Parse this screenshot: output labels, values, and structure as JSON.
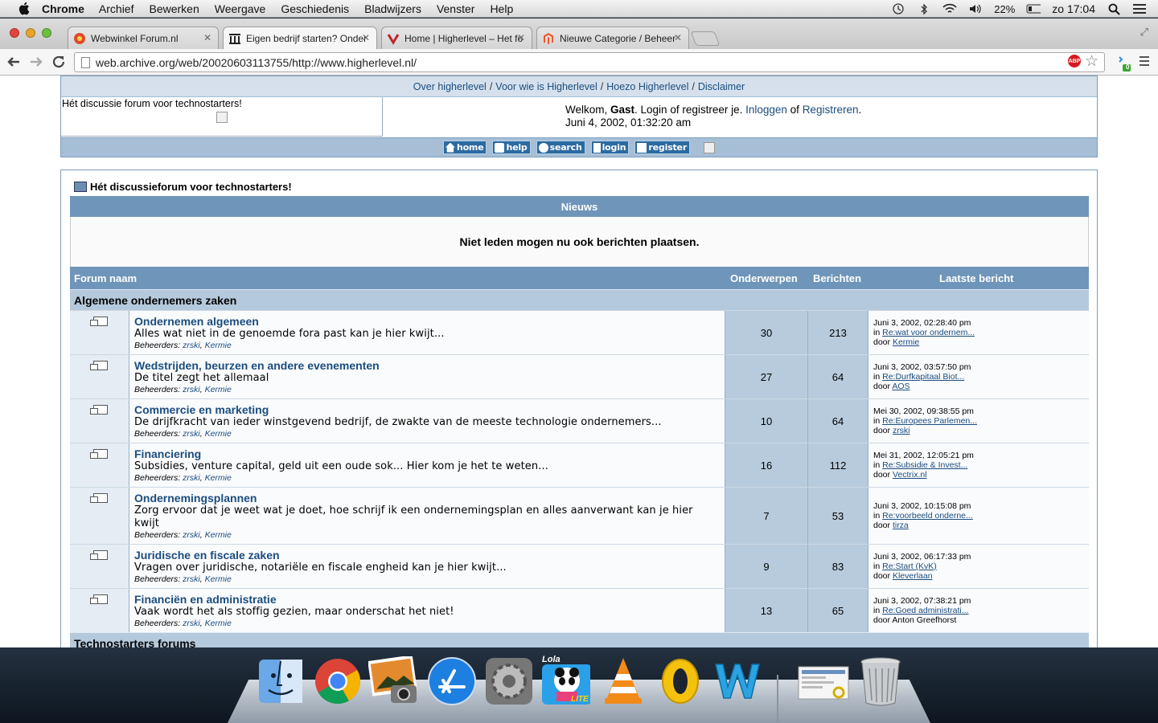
{
  "menubar": {
    "app": "Chrome",
    "items": [
      "Archief",
      "Bewerken",
      "Weergave",
      "Geschiedenis",
      "Bladwijzers",
      "Venster",
      "Help"
    ],
    "battery": "22%",
    "clock": "zo 17:04"
  },
  "tabs": [
    {
      "title": "Webwinkel Forum.nl",
      "active": false
    },
    {
      "title": "Eigen bedrijf starten? Onder",
      "active": true
    },
    {
      "title": "Home | Higherlevel – Het fo",
      "active": false
    },
    {
      "title": "Nieuwe Categorie / Beheer",
      "active": false
    }
  ],
  "address": "web.archive.org/web/20020603113755/http://www.higherlevel.nl/",
  "extension_badge": "0",
  "abp_label": "ABP",
  "site": {
    "topnav": [
      "Over higherlevel",
      "Voor wie is Higherlevel",
      "Hoezo Higherlevel",
      "Disclaimer"
    ],
    "tagline": "Hét discussie forum voor technostarters!",
    "welcome": {
      "prefix": "Welkom, ",
      "guest": "Gast",
      "mid": ". Login of registreer je. ",
      "login_link": "Inloggen",
      "of": " of ",
      "register_link": "Registreren",
      "suffix": ".",
      "date": "Juni 4, 2002, 01:32:20 am"
    },
    "buttons": [
      "home",
      "help",
      "search",
      "login",
      "register"
    ]
  },
  "board": {
    "title": "Hét discussieforum voor technostarters!",
    "news_header": "Nieuws",
    "news_text": "Niet leden mogen nu ook berichten plaatsen.",
    "columns": {
      "name": "Forum naam",
      "topics": "Onderwerpen",
      "posts": "Berichten",
      "last": "Laatste bericht"
    },
    "category": "Algemene ondernemers zaken",
    "next_category": "Technostarters forums",
    "mods_label": "Beheerders:",
    "mods": [
      "zrski",
      "Kermie"
    ],
    "forums": [
      {
        "name": "Ondernemen algemeen",
        "desc": "Alles wat niet in de genoemde fora past kan je hier kwijt...",
        "topics": "30",
        "posts": "213",
        "last_date": "Juni 3, 2002, 02:28:40 pm",
        "last_topic": "Re:wat voor ondernem...",
        "last_by": "Kermie",
        "by_link": true
      },
      {
        "name": "Wedstrijden, beurzen en andere evenementen",
        "desc": "De titel zegt het allemaal",
        "topics": "27",
        "posts": "64",
        "last_date": "Juni 3, 2002, 03:57:50 pm",
        "last_topic": "Re:Durfkapitaal Biot...",
        "last_by": "AOS",
        "by_link": true
      },
      {
        "name": "Commercie en marketing",
        "desc": "De drijfkracht van ieder winstgevend bedrijf, de zwakte van de meeste technologie ondernemers...",
        "topics": "10",
        "posts": "64",
        "last_date": "Mei 30, 2002, 09:38:55 pm",
        "last_topic": "Re:Europees Parlemen...",
        "last_by": "zrski",
        "by_link": true
      },
      {
        "name": "Financiering",
        "desc": "Subsidies, venture capital, geld uit een oude sok... Hier kom je het te weten...",
        "topics": "16",
        "posts": "112",
        "last_date": "Mei 31, 2002, 12:05:21 pm",
        "last_topic": "Re:Subsidie & Invest...",
        "last_by": "Vectrix.nl",
        "by_link": true
      },
      {
        "name": "Ondernemingsplannen",
        "desc": "Zorg ervoor dat je weet wat je doet, hoe schrijf ik een ondernemingsplan en alles aanverwant kan je hier kwijt",
        "topics": "7",
        "posts": "53",
        "last_date": "Juni 3, 2002, 10:15:08 pm",
        "last_topic": "Re:voorbeeld onderne...",
        "last_by": "tirza",
        "by_link": true
      },
      {
        "name": "Juridische en fiscale zaken",
        "desc": "Vragen over juridische, notariële en fiscale engheid kan je hier kwijt...",
        "topics": "9",
        "posts": "83",
        "last_date": "Juni 3, 2002, 06:17:33 pm",
        "last_topic": "Re:Start (KvK)",
        "last_by": "Kleverlaan",
        "by_link": true
      },
      {
        "name": "Financiën en administratie",
        "desc": "Vaak wordt het als stoffig gezien, maar onderschat het niet!",
        "topics": "13",
        "posts": "65",
        "last_date": "Juni 3, 2002, 07:38:21 pm",
        "last_topic": "Re:Goed administrati...",
        "last_by": "Anton Greefhorst",
        "by_link": false
      }
    ],
    "in_label": "in",
    "door_label": "door"
  },
  "dock": [
    "Finder",
    "Chrome",
    "iPhoto",
    "App Store",
    "Systeemvoorkeuren",
    "Lola",
    "VLC",
    "Outlook",
    "Word",
    "Preview",
    "Prullenmand"
  ],
  "dock_badges": {
    "lola": "Lola",
    "lite": "LITE"
  }
}
